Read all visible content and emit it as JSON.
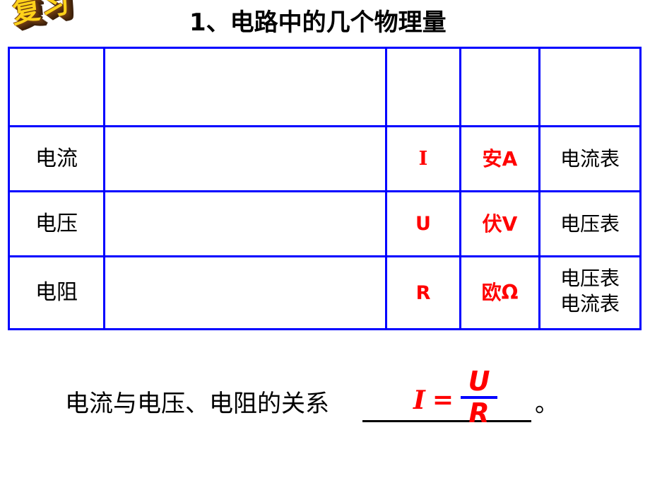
{
  "wordart": {
    "text": "复习",
    "fill_color": "#FFD21A",
    "shadow_color": "#4e2a0c"
  },
  "title": "1、电路中的几个物理量",
  "table": {
    "columns": [
      "",
      "",
      "",
      "",
      ""
    ],
    "header_row": [
      "",
      "",
      "",
      "",
      ""
    ],
    "rows": [
      {
        "name": "电流",
        "definition": "",
        "symbol": "I",
        "unit": "安A",
        "meter": "电流表",
        "meter_line2": ""
      },
      {
        "name": "电压",
        "definition": "",
        "symbol": "U",
        "unit": "伏V",
        "meter": "电压表",
        "meter_line2": ""
      },
      {
        "name": "电阻",
        "definition": "",
        "symbol": "R",
        "unit": "欧Ω",
        "meter": "电压表",
        "meter_line2": "电流表"
      }
    ],
    "border_color": "#0000FF",
    "symbol_color": "#FF0000",
    "unit_color": "#FF0000",
    "text_color": "#000000"
  },
  "relation": {
    "label": "电流与电压、电阻的关系",
    "blank": "",
    "period": "。"
  },
  "formula": {
    "variable": "I",
    "equals": "=",
    "numerator": "U",
    "denominator": "R",
    "bar_color": "#0000FF",
    "text_color": "#FF0000"
  }
}
